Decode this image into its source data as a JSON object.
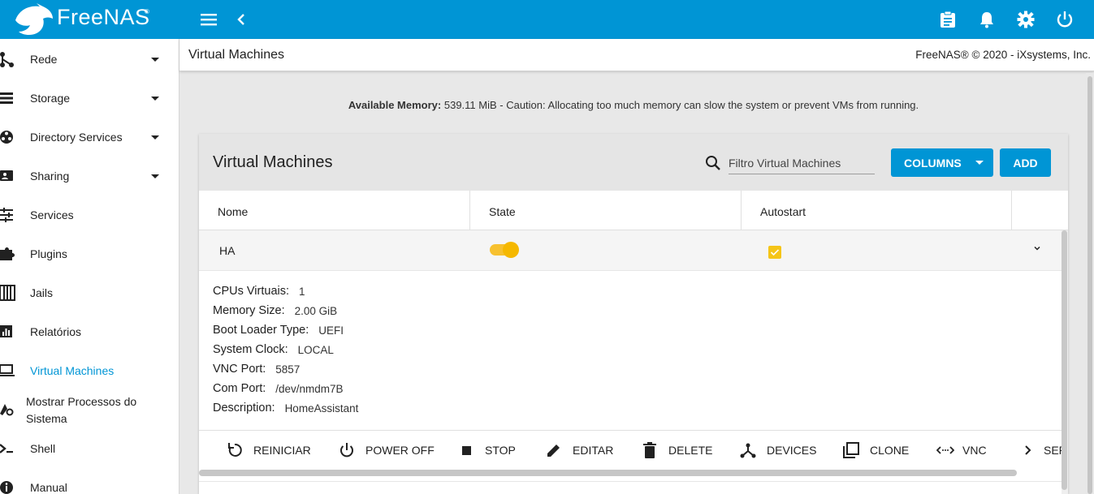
{
  "app": {
    "brand": "FreeNAS",
    "brand_mark": "®",
    "brand_color": "#0095d5"
  },
  "topbar": {
    "icons": [
      "menu-icon",
      "chevron-left-icon",
      "clipboard-icon",
      "bell-icon",
      "gear-icon",
      "power-icon"
    ]
  },
  "sidebar": {
    "items": [
      {
        "label": "Rede",
        "icon": "network-icon",
        "expandable": true
      },
      {
        "label": "Storage",
        "icon": "storage-icon",
        "expandable": true
      },
      {
        "label": "Directory Services",
        "icon": "directory-icon",
        "expandable": true
      },
      {
        "label": "Sharing",
        "icon": "sharing-icon",
        "expandable": true
      },
      {
        "label": "Services",
        "icon": "services-icon",
        "expandable": false
      },
      {
        "label": "Plugins",
        "icon": "puzzle-icon",
        "expandable": false
      },
      {
        "label": "Jails",
        "icon": "jail-icon",
        "expandable": false
      },
      {
        "label": "Relatórios",
        "icon": "chart-icon",
        "expandable": false
      },
      {
        "label": "Virtual Machines",
        "icon": "laptop-icon",
        "expandable": false,
        "active": true
      },
      {
        "label_line1": "Mostrar Processos do",
        "label_line2": "Sistema",
        "icon": "process-icon",
        "expandable": false
      },
      {
        "label": "Shell",
        "icon": "terminal-icon",
        "expandable": false
      },
      {
        "label": "Manual",
        "icon": "info-icon",
        "expandable": false
      }
    ]
  },
  "header": {
    "title": "Virtual Machines",
    "copyright": "FreeNAS® © 2020 - iXsystems, Inc."
  },
  "memory": {
    "label": "Available Memory:",
    "text": " 539.11 MiB - Caution: Allocating too much memory can slow the system or prevent VMs from running."
  },
  "card": {
    "title": "Virtual Machines",
    "search_placeholder": "Filtro Virtual Machines",
    "columns_label": "COLUMNS",
    "add_label": "ADD",
    "columns": [
      "Nome",
      "State",
      "Autostart"
    ],
    "row": {
      "name": "HA",
      "state_on": true,
      "autostart": true
    },
    "details": [
      {
        "key": "CPUs Virtuais:",
        "value": "1"
      },
      {
        "key": "Memory Size:",
        "value": "2.00 GiB"
      },
      {
        "key": "Boot Loader Type:",
        "value": "UEFI"
      },
      {
        "key": "System Clock:",
        "value": "LOCAL"
      },
      {
        "key": "VNC Port:",
        "value": "5857"
      },
      {
        "key": "Com Port:",
        "value": "/dev/nmdm7B"
      },
      {
        "key": "Description:",
        "value": "HomeAssistant"
      }
    ],
    "actions": [
      {
        "label": "REINICIAR",
        "icon": "restart-icon"
      },
      {
        "label": "POWER OFF",
        "icon": "power-icon"
      },
      {
        "label": "STOP",
        "icon": "stop-icon"
      },
      {
        "label": "EDITAR",
        "icon": "pencil-icon"
      },
      {
        "label": "DELETE",
        "icon": "trash-icon"
      },
      {
        "label": "DEVICES",
        "icon": "devices-icon"
      },
      {
        "label": "CLONE",
        "icon": "clone-icon"
      },
      {
        "label": "VNC",
        "icon": "vnc-icon"
      },
      {
        "label": "SER",
        "icon": "chevron-right-icon"
      }
    ]
  },
  "colors": {
    "accent": "#0095d5",
    "toggle": "#f5b800",
    "checkbox": "#f5c518"
  }
}
